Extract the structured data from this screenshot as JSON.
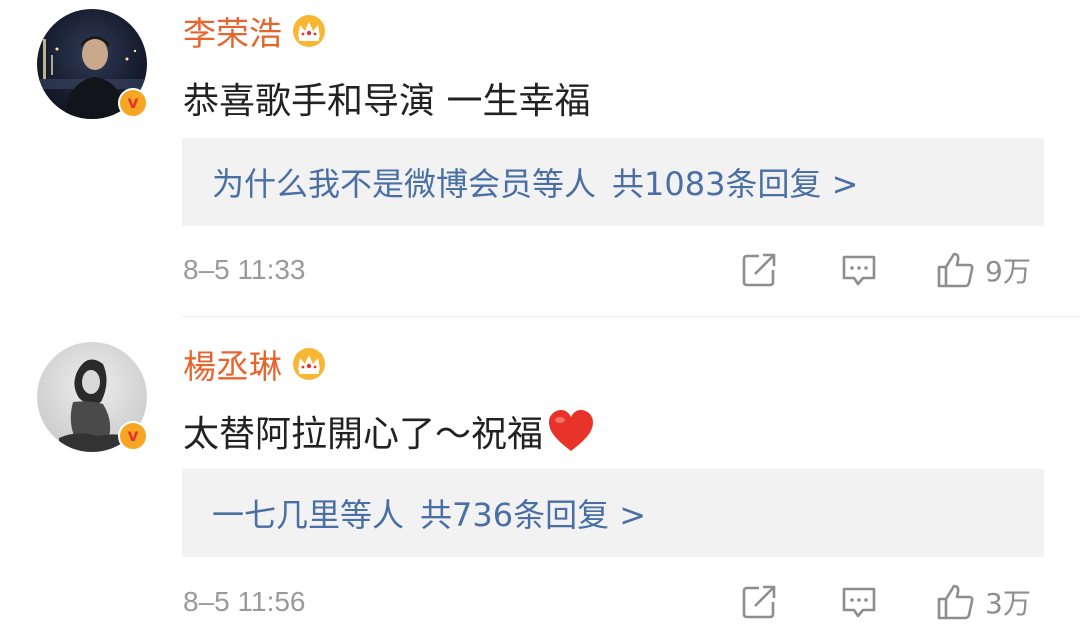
{
  "comments": [
    {
      "username": "李荣浩",
      "text": "恭喜歌手和导演 一生幸福",
      "reply_users": "为什么我不是微博会员等人",
      "reply_count": "共1083条回复 >",
      "timestamp": "8–5 11:33",
      "likes": "9万",
      "verified_label": "v"
    },
    {
      "username": "楊丞琳",
      "text": "太替阿拉開心了～祝福",
      "reply_users": "一七几里等人",
      "reply_count": "共736条回复 >",
      "timestamp": "8–5 11:56",
      "likes": "3万",
      "verified_label": "v"
    }
  ],
  "colors": {
    "username": "#e8642e",
    "reply_link": "#4a6fa5",
    "reply_bg": "#f2f2f2",
    "meta_text": "#9a9a9a",
    "heart": "#e8332b",
    "badge": "#f6a623"
  },
  "icons": {
    "crown": "vip-crown-icon",
    "share": "share-edit-icon",
    "comment": "comment-bubble-icon",
    "like": "thumbs-up-icon",
    "heart": "red-heart-emoji",
    "verified": "verified-v-badge-icon"
  }
}
